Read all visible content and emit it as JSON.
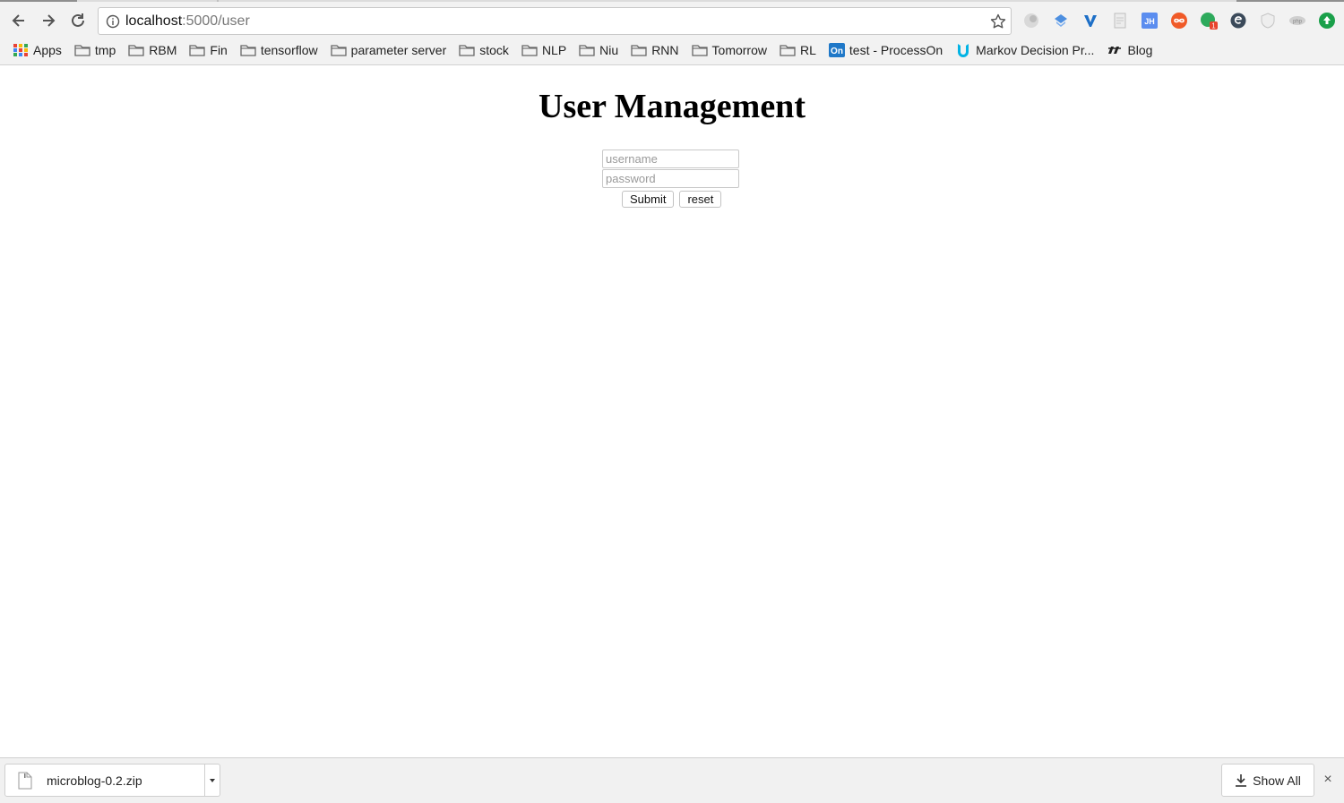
{
  "browser": {
    "url_host": "localhost",
    "url_rest": ":5000/user",
    "extensions": [
      {
        "icon": "globe-extension-icon"
      },
      {
        "icon": "diamond-extension-icon"
      },
      {
        "icon": "v-extension-icon"
      },
      {
        "icon": "page-extension-icon"
      },
      {
        "icon": "jh-extension-icon",
        "label": "JH"
      },
      {
        "icon": "infinity-extension-icon"
      },
      {
        "icon": "notification-extension-icon",
        "badge": "1"
      },
      {
        "icon": "e-extension-icon"
      },
      {
        "icon": "shield-extension-icon"
      },
      {
        "icon": "php-extension-icon",
        "label": "php"
      },
      {
        "icon": "upload-extension-icon"
      }
    ]
  },
  "bookmarks": [
    {
      "label": "Apps",
      "icon": "apps-grid-icon"
    },
    {
      "label": "tmp",
      "icon": "folder-icon"
    },
    {
      "label": "RBM",
      "icon": "folder-icon"
    },
    {
      "label": "Fin",
      "icon": "folder-icon"
    },
    {
      "label": "tensorflow",
      "icon": "folder-icon"
    },
    {
      "label": "parameter server",
      "icon": "folder-icon"
    },
    {
      "label": "stock",
      "icon": "folder-icon"
    },
    {
      "label": "NLP",
      "icon": "folder-icon"
    },
    {
      "label": "Niu",
      "icon": "folder-icon"
    },
    {
      "label": "RNN",
      "icon": "folder-icon"
    },
    {
      "label": "Tomorrow",
      "icon": "folder-icon"
    },
    {
      "label": "RL",
      "icon": "folder-icon"
    },
    {
      "label": "test - ProcessOn",
      "icon": "processon-icon",
      "badge": "On"
    },
    {
      "label": "Markov Decision Pr...",
      "icon": "udacity-icon"
    },
    {
      "label": "Blog",
      "icon": "blog-icon"
    }
  ],
  "page": {
    "title": "User Management",
    "username_placeholder": "username",
    "password_placeholder": "password",
    "submit_label": "Submit",
    "reset_label": "reset"
  },
  "downloads": {
    "file_name": "microblog-0.2.zip",
    "show_all_label": "Show All",
    "close_glyph": "×"
  },
  "colors": {
    "chrome_bg": "#f2f2f2",
    "shelf_bg": "#f1f1f1",
    "jh_blue": "#5b8def",
    "upload_green": "#1aa04a"
  }
}
